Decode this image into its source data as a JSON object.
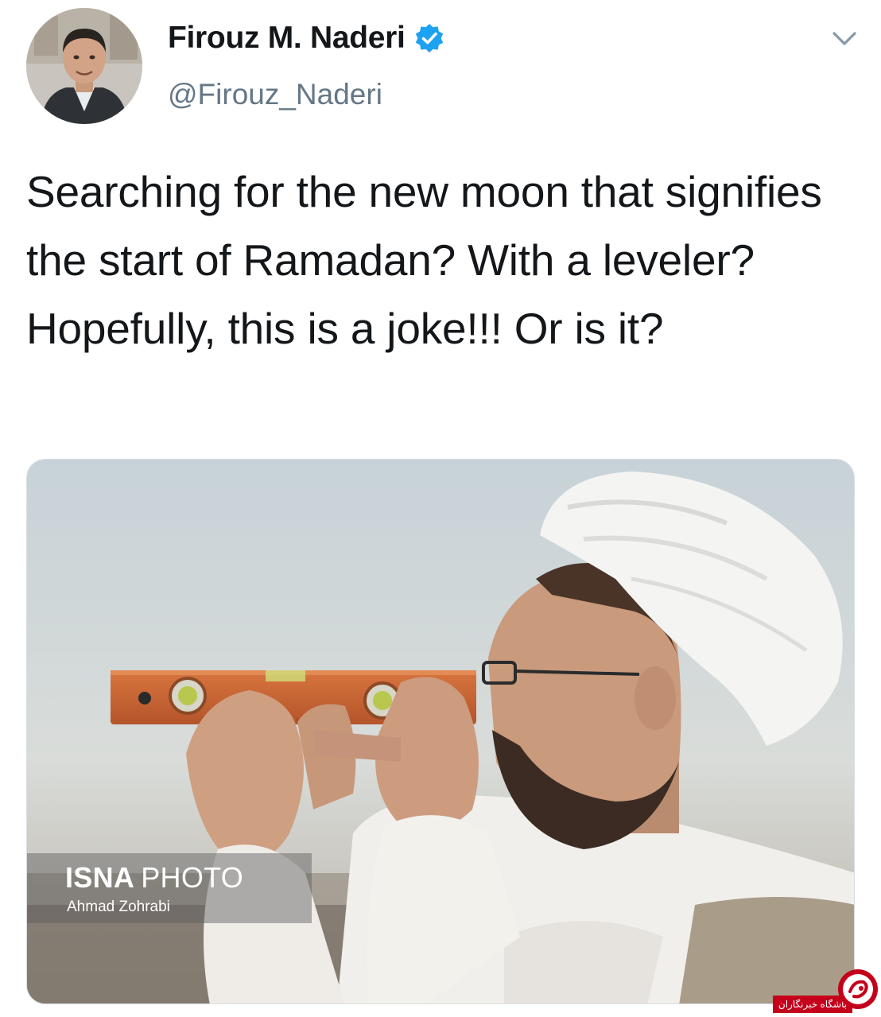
{
  "tweet": {
    "author": {
      "display_name": "Firouz M. Naderi",
      "handle": "@Firouz_Naderi",
      "verified": true,
      "avatar_icon": "user-avatar"
    },
    "text": "Searching for the new moon that signifies the start of Ramadan? With a leveler? Hopefully, this is a joke!!! Or is it?",
    "menu_icon": "chevron-down-icon"
  },
  "media": {
    "watermark": {
      "brand": "ISNA",
      "label": "PHOTO",
      "credit": "Ahmad Zohrabi"
    }
  },
  "corner_logo": {
    "text": "باشگاه خبرنگاران"
  },
  "colors": {
    "text_primary": "#14171a",
    "text_secondary": "#657786",
    "verified_blue": "#1da1f2",
    "logo_red": "#c4001a"
  }
}
